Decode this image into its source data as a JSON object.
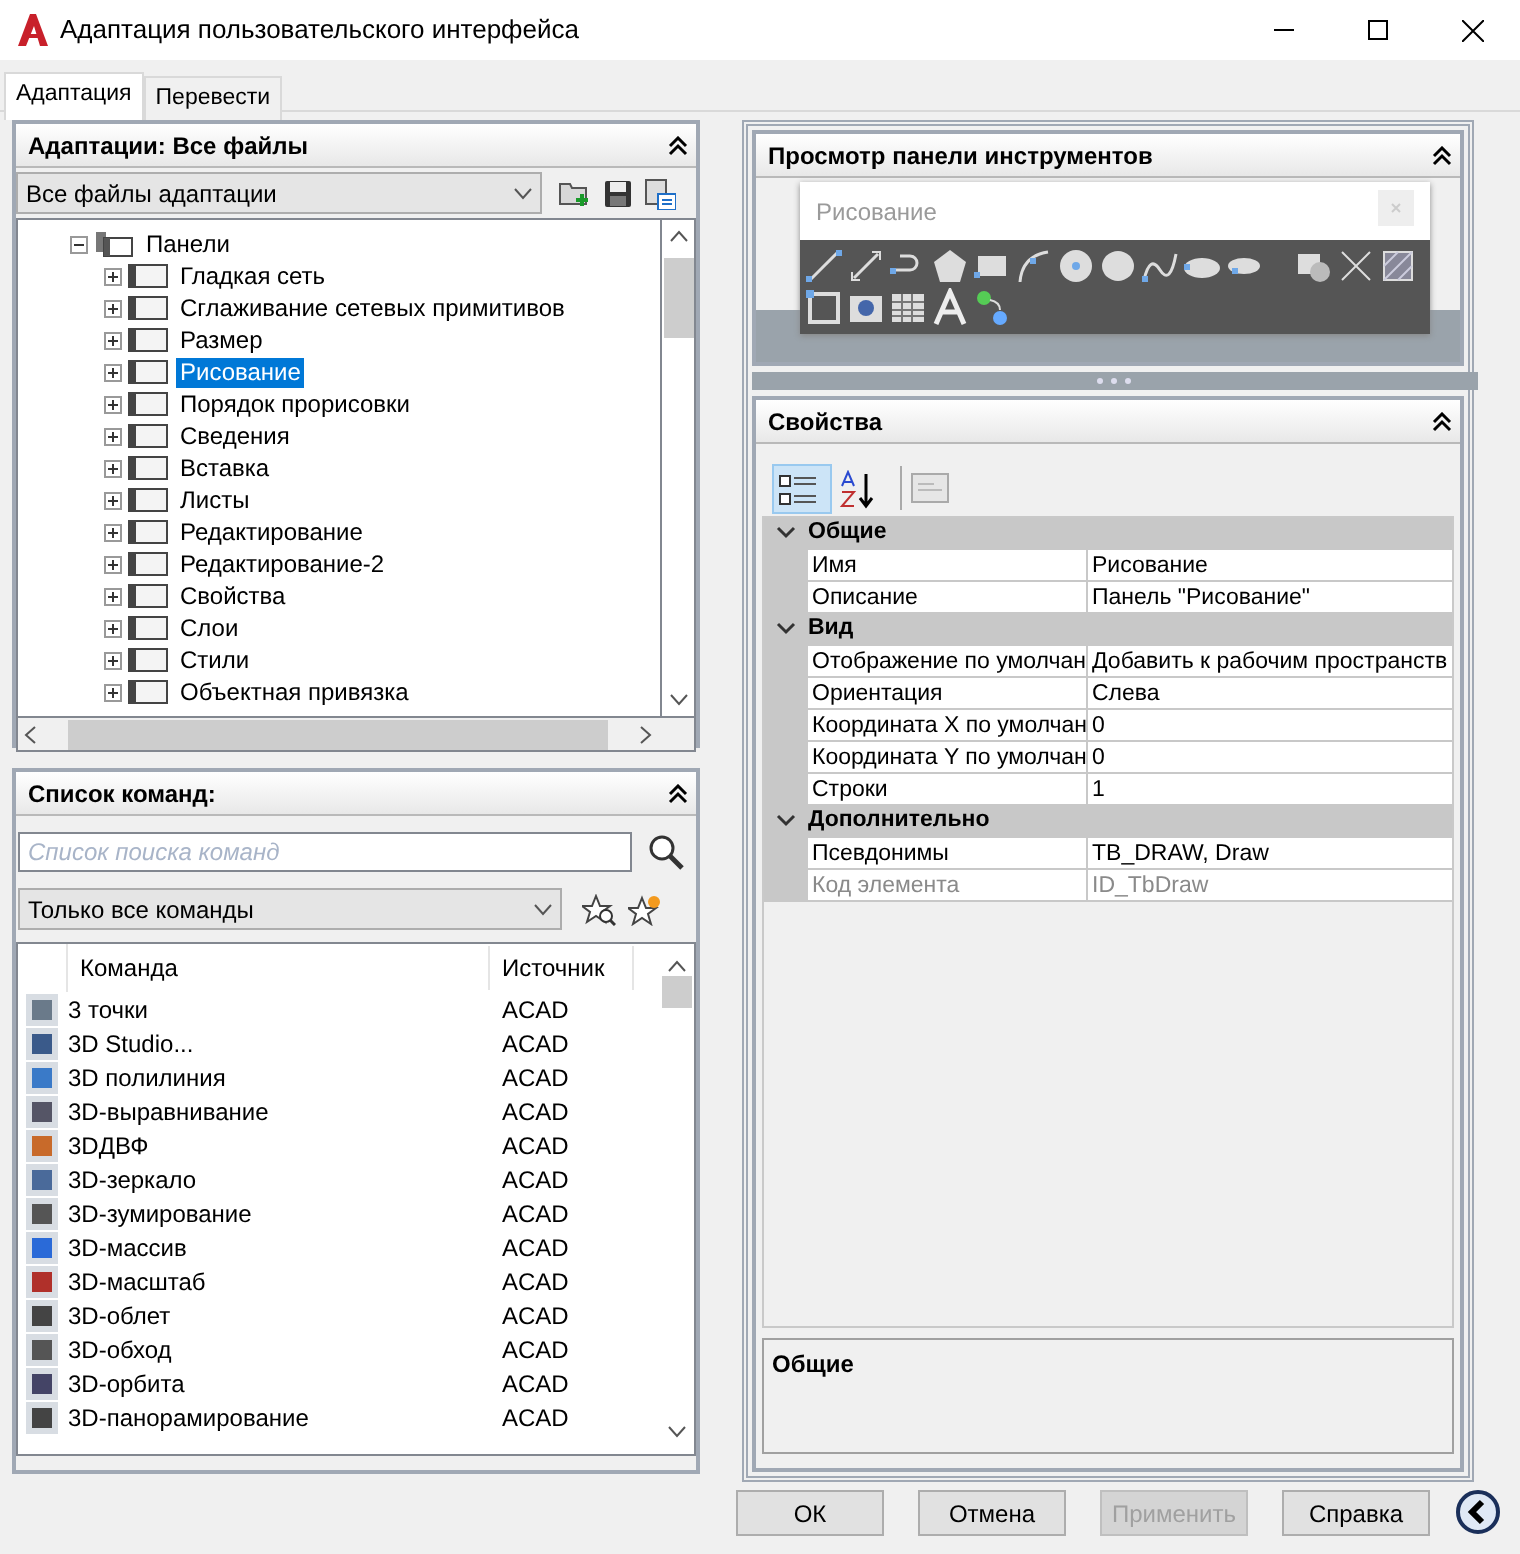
{
  "window": {
    "title": "Адаптация пользовательского интерфейса"
  },
  "tabs": [
    {
      "label": "Адаптация",
      "selected": true
    },
    {
      "label": "Перевести",
      "selected": false
    }
  ],
  "customizations_panel": {
    "title": "Адаптации: Все файлы",
    "file_select": "Все файлы адаптации",
    "tree": [
      {
        "label": "Панели",
        "expanded": true,
        "selected": false,
        "children": [
          {
            "label": "Гладкая сеть",
            "expanded": false,
            "selected": false
          },
          {
            "label": "Сглаживание сетевых примитивов",
            "expanded": false,
            "selected": false
          },
          {
            "label": "Размер",
            "expanded": false,
            "selected": false
          },
          {
            "label": "Рисование",
            "expanded": false,
            "selected": true
          },
          {
            "label": "Порядок прорисовки",
            "expanded": false,
            "selected": false
          },
          {
            "label": "Сведения",
            "expanded": false,
            "selected": false
          },
          {
            "label": "Вставка",
            "expanded": false,
            "selected": false
          },
          {
            "label": "Листы",
            "expanded": false,
            "selected": false
          },
          {
            "label": "Редактирование",
            "expanded": false,
            "selected": false
          },
          {
            "label": "Редактирование-2",
            "expanded": false,
            "selected": false
          },
          {
            "label": "Свойства",
            "expanded": false,
            "selected": false
          },
          {
            "label": "Слои",
            "expanded": false,
            "selected": false
          },
          {
            "label": "Стили",
            "expanded": false,
            "selected": false
          },
          {
            "label": "Объектная привязка",
            "expanded": false,
            "selected": false
          }
        ]
      }
    ]
  },
  "command_list_panel": {
    "title": "Список команд:",
    "search": {
      "placeholder": "Список поиска команд"
    },
    "filter_select": "Только все команды",
    "columns": [
      "Команда",
      "Источник"
    ],
    "rows": [
      {
        "command": "3 точки",
        "source": "ACAD"
      },
      {
        "command": "3D Studio...",
        "source": "ACAD"
      },
      {
        "command": "3D полилиния",
        "source": "ACAD"
      },
      {
        "command": "3D-выравнивание",
        "source": "ACAD"
      },
      {
        "command": "3DДВФ",
        "source": "ACAD"
      },
      {
        "command": "3D-зеркало",
        "source": "ACAD"
      },
      {
        "command": "3D-зумирование",
        "source": "ACAD"
      },
      {
        "command": "3D-массив",
        "source": "ACAD"
      },
      {
        "command": "3D-масштаб",
        "source": "ACAD"
      },
      {
        "command": "3D-облет",
        "source": "ACAD"
      },
      {
        "command": "3D-обход",
        "source": "ACAD"
      },
      {
        "command": "3D-орбита",
        "source": "ACAD"
      },
      {
        "command": "3D-панорамирование",
        "source": "ACAD"
      }
    ]
  },
  "toolbar_preview_panel": {
    "title": "Просмотр панели инструментов",
    "toolbar_title": "Рисование"
  },
  "properties_panel": {
    "title": "Свойства",
    "view_modes": [
      {
        "kind": "categorized",
        "selected": true
      },
      {
        "kind": "alphabetical",
        "selected": false
      }
    ],
    "categories": [
      {
        "name": "Общие",
        "expanded": true,
        "properties": [
          {
            "name": "Имя",
            "value": "Рисование",
            "disabled": false
          },
          {
            "name": "Описание",
            "value": "Панель \"Рисование\"",
            "disabled": false
          }
        ]
      },
      {
        "name": "Вид",
        "expanded": true,
        "properties": [
          {
            "name": "Отображение по умолчан",
            "value": "Добавить к рабочим пространств",
            "disabled": false
          },
          {
            "name": "Ориентация",
            "value": "Слева",
            "disabled": false
          },
          {
            "name": "Координата X по умолчан",
            "value": "0",
            "disabled": false
          },
          {
            "name": "Координата Y по умолчан",
            "value": "0",
            "disabled": false
          },
          {
            "name": "Строки",
            "value": "1",
            "disabled": false
          }
        ]
      },
      {
        "name": "Дополнительно",
        "expanded": true,
        "properties": [
          {
            "name": "Псевдонимы",
            "value": "TB_DRAW, Draw",
            "disabled": false
          },
          {
            "name": "Код элемента",
            "value": "ID_TbDraw",
            "disabled": true
          }
        ]
      }
    ],
    "description_title": "Общие"
  },
  "buttons": [
    {
      "label": "ОК",
      "disabled": false
    },
    {
      "label": "Отмена",
      "disabled": false
    },
    {
      "label": "Применить",
      "disabled": true
    },
    {
      "label": "Справка",
      "disabled": false
    }
  ]
}
